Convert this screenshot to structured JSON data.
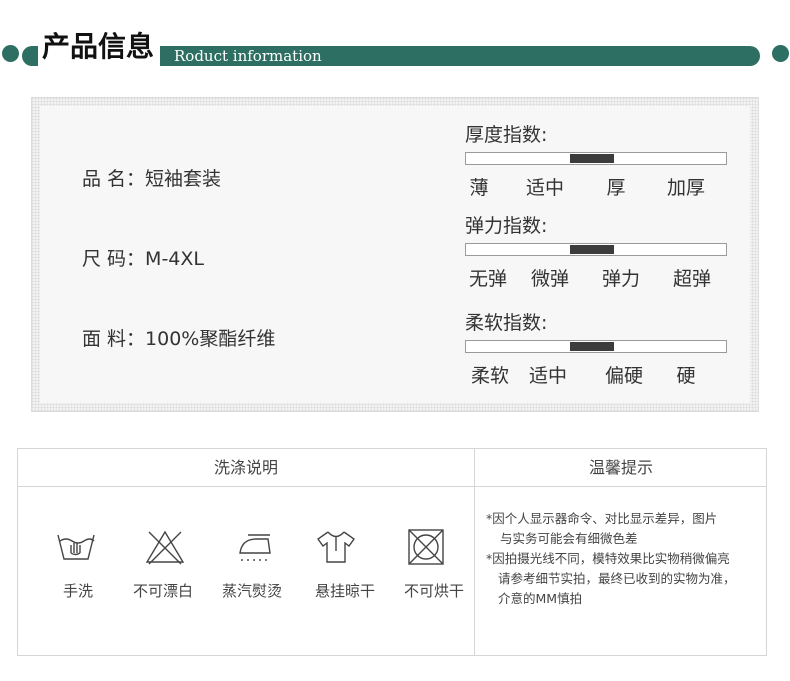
{
  "header": {
    "title_cn": "产品信息",
    "title_en": "Roduct information"
  },
  "specs": [
    {
      "label": "品 名：",
      "value": "短袖套装"
    },
    {
      "label": "尺 码：",
      "value": "M-4XL"
    },
    {
      "label": "面 料：",
      "value": "100%聚酯纤维"
    }
  ],
  "indices": [
    {
      "title": "厚度指数:",
      "levels": [
        "薄",
        "适中",
        "厚",
        "加厚"
      ],
      "level_range": [
        0.4,
        0.57
      ]
    },
    {
      "title": "弹力指数:",
      "levels": [
        "无弹",
        "微弹",
        "弹力",
        "超弹"
      ],
      "level_range": [
        0.4,
        0.57
      ]
    },
    {
      "title": "柔软指数:",
      "levels": [
        "柔软",
        "适中",
        "偏硬",
        "硬"
      ],
      "level_range": [
        0.4,
        0.57
      ]
    }
  ],
  "care": {
    "header": "洗涤说明",
    "items": [
      {
        "icon": "hand-wash-icon",
        "label": "手洗"
      },
      {
        "icon": "no-bleach-icon",
        "label": "不可漂白"
      },
      {
        "icon": "steam-iron-icon",
        "label": "蒸汽熨烫"
      },
      {
        "icon": "hang-dry-icon",
        "label": "悬挂晾干"
      },
      {
        "icon": "no-tumble-dry-icon",
        "label": "不可烘干"
      }
    ]
  },
  "tips": {
    "header": "温馨提示",
    "lines": [
      "*因个人显示器命令、对比显示差异，图片",
      "与实务可能会有细微色差",
      "*因拍摄光线不同，模特效果比实物稍微偏亮",
      "请参考细节实拍，最终已收到的实物为准，",
      "介意的MM慎拍"
    ]
  },
  "colors": {
    "accent": "#2d6f62",
    "bar_fill": "#3c3c3c"
  }
}
